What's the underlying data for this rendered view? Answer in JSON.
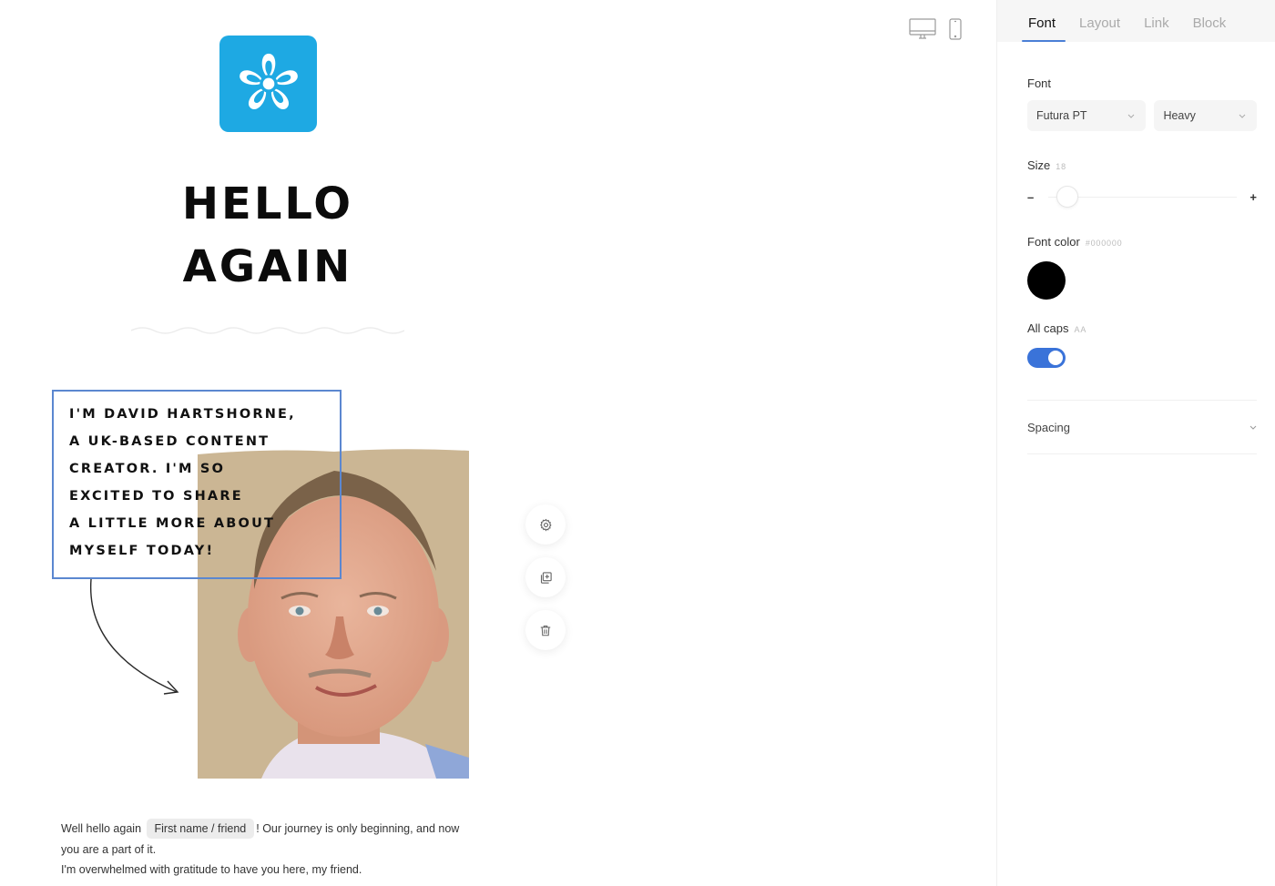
{
  "canvas": {
    "device_toggle": [
      {
        "icon": "desktop-icon",
        "label": "Desktop view"
      },
      {
        "icon": "mobile-icon",
        "label": "Mobile view"
      }
    ],
    "logo": {
      "icon": "flower-icon",
      "color": "#1ea9e3"
    },
    "headline": [
      "HELLO",
      "AGAIN"
    ],
    "intro_lines": [
      "I'M DAVID HARTSHORNE,",
      "A UK-BASED CONTENT",
      "CREATOR. I'M SO",
      "EXCITED TO SHARE",
      "A LITTLE MORE ABOUT",
      "MYSELF TODAY!"
    ],
    "selection_color": "#5b87d0",
    "block_tools": [
      {
        "icon": "gear-icon",
        "label": "Settings"
      },
      {
        "icon": "duplicate-icon",
        "label": "Duplicate"
      },
      {
        "icon": "trash-icon",
        "label": "Delete"
      }
    ],
    "body": {
      "before_tag": "Well hello again",
      "merge_tag": "First name / friend",
      "after_tag": "! Our journey is only beginning, and now you are a part of it.",
      "line2": "I'm overwhelmed with gratitude to have you here, my friend."
    }
  },
  "panel": {
    "tabs": [
      {
        "label": "Font",
        "active": true
      },
      {
        "label": "Layout",
        "active": false
      },
      {
        "label": "Link",
        "active": false
      },
      {
        "label": "Block",
        "active": false
      }
    ],
    "font": {
      "label": "Font",
      "family": "Futura PT",
      "weight": "Heavy"
    },
    "size": {
      "label": "Size",
      "value": "18",
      "minus": "–",
      "plus": "+",
      "slider_fraction": 0.06
    },
    "font_color": {
      "label": "Font color",
      "value": "#000000"
    },
    "all_caps": {
      "label": "All caps",
      "hint": "AA",
      "enabled": true,
      "accent": "#3a73d9"
    },
    "spacing": {
      "label": "Spacing"
    }
  }
}
